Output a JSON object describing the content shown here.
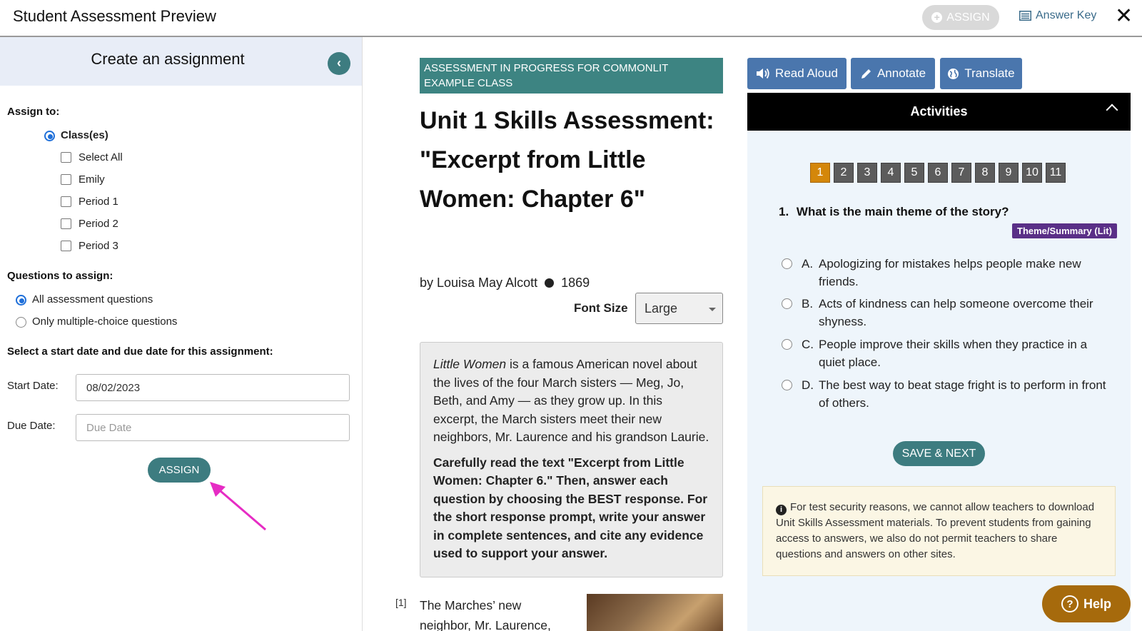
{
  "header": {
    "title": "Student Assessment Preview",
    "assign_label": "ASSIGN",
    "answer_key_label": "Answer Key",
    "close_glyph": "✕"
  },
  "assignment_panel": {
    "title": "Create an assignment",
    "assign_to_label": "Assign to:",
    "classes_label": "Class(es)",
    "class_options": [
      "Select All",
      "Emily",
      "Period 1",
      "Period 2",
      "Period 3"
    ],
    "questions_label": "Questions to assign:",
    "question_options": [
      "All assessment questions",
      "Only multiple-choice questions"
    ],
    "dates_label": "Select a start date and due date for this assignment:",
    "start_date_label": "Start Date:",
    "start_date_value": "08/02/2023",
    "due_date_label": "Due Date:",
    "due_date_placeholder": "Due Date",
    "assign_button": "ASSIGN"
  },
  "text_panel": {
    "banner": "ASSESSMENT IN PROGRESS FOR COMMONLIT EXAMPLE CLASS",
    "title": "Unit 1 Skills Assessment: \"Excerpt from Little Women: Chapter 6\"",
    "author": "by Louisa May Alcott",
    "year": "1869",
    "font_size_label": "Font Size",
    "font_size_value": "Large",
    "intro_italic": "Little Women",
    "intro_rest": " is a famous American novel about the lives of the four March sisters — Meg, Jo, Beth, and Amy — as they grow up. In this excerpt, the March sisters meet their new neighbors, Mr. Laurence and his grandson Laurie.",
    "instructions": "Carefully read the text \"Excerpt from Little Women: Chapter 6.\" Then, answer each question by choosing the BEST response. For the short response prompt, write your answer in complete sentences, and cite any evidence used to support your answer.",
    "para_number": "[1]",
    "para_text": "The Marches’ new neighbor, Mr. Laurence,"
  },
  "activity_panel": {
    "tools": [
      "Read Aloud",
      "Annotate",
      "Translate"
    ],
    "activities_label": "Activities",
    "question_numbers": [
      "1",
      "2",
      "3",
      "4",
      "5",
      "6",
      "7",
      "8",
      "9",
      "10",
      "11"
    ],
    "active_question": "1",
    "question_number": "1.",
    "question_text": "What is the main theme of the story?",
    "skill_tag": "Theme/Summary (Lit)",
    "choices": [
      {
        "letter": "A.",
        "text": "Apologizing for mistakes helps people make new friends."
      },
      {
        "letter": "B.",
        "text": "Acts of kindness can help someone overcome their shyness."
      },
      {
        "letter": "C.",
        "text": "People improve their skills when they practice in a quiet place."
      },
      {
        "letter": "D.",
        "text": "The best way to beat stage fright is to perform in front of others."
      }
    ],
    "save_next_label": "SAVE & NEXT",
    "notice": "For test security reasons, we cannot allow teachers to download Unit Skills Assessment materials. To prevent students from gaining access to answers, we also do not permit teachers to share questions and answers on other sites.",
    "help_label": "Help"
  },
  "colors": {
    "teal": "#3d7c80",
    "tool_blue": "#4a76ad",
    "active_number": "#d4870a",
    "skill_tag": "#5a2f87",
    "help": "#a66a0c",
    "arrow": "#e62cc4"
  }
}
